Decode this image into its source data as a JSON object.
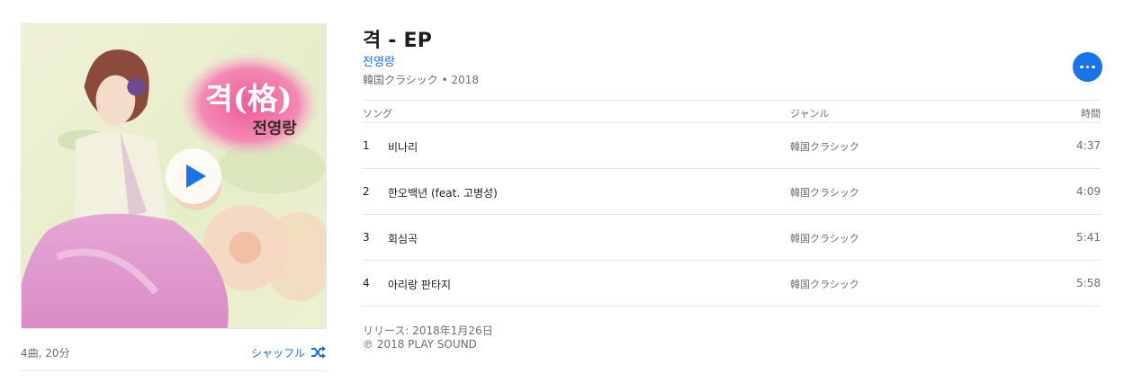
{
  "album": {
    "title": "격 - EP",
    "artist": "전영랑",
    "genre_year": "韓国クラシック • 2018",
    "cover_text_main": "격(格)",
    "cover_text_artist": "전영랑"
  },
  "summary": {
    "count_duration": "4曲, 20分",
    "shuffle_label": "シャッフル"
  },
  "table": {
    "headers": {
      "song": "ソング",
      "genre": "ジャンル",
      "time": "時間"
    },
    "tracks": [
      {
        "num": "1",
        "title": "비나리",
        "genre": "韓国クラシック",
        "time": "4:37"
      },
      {
        "num": "2",
        "title": "한오백년 (feat. 고병성)",
        "genre": "韓国クラシック",
        "time": "4:09"
      },
      {
        "num": "3",
        "title": "회심곡",
        "genre": "韓国クラシック",
        "time": "5:41"
      },
      {
        "num": "4",
        "title": "아리랑 판타지",
        "genre": "韓国クラシック",
        "time": "5:58"
      }
    ]
  },
  "footer": {
    "release": "リリース:  2018年1月26日",
    "copyright": "℗ 2018 PLAY SOUND"
  },
  "colors": {
    "accent": "#1a6fd8",
    "more_button": "#1a73e8",
    "cover_pink": "#e46aa0"
  },
  "icons": {
    "play": "play-icon",
    "shuffle": "shuffle-icon",
    "more": "more-icon"
  }
}
